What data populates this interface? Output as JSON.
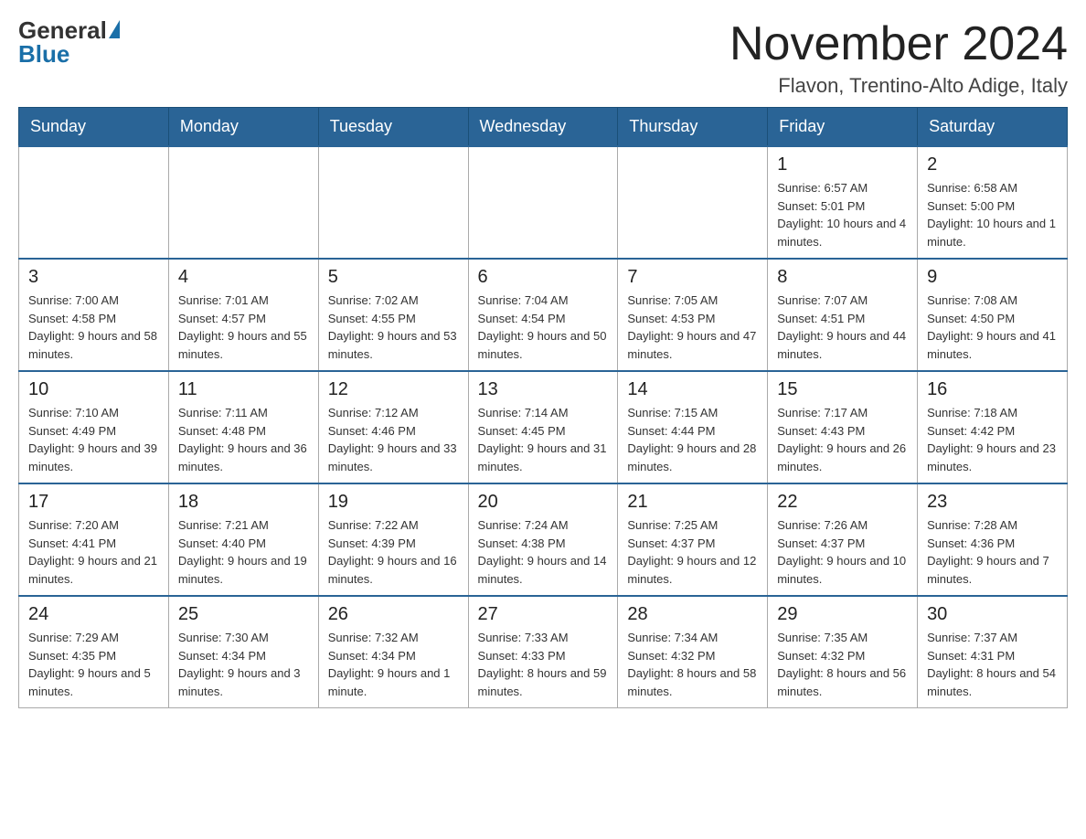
{
  "logo": {
    "general": "General",
    "blue": "Blue",
    "triangle": "▶"
  },
  "header": {
    "month_title": "November 2024",
    "location": "Flavon, Trentino-Alto Adige, Italy"
  },
  "weekdays": [
    "Sunday",
    "Monday",
    "Tuesday",
    "Wednesday",
    "Thursday",
    "Friday",
    "Saturday"
  ],
  "weeks": [
    [
      {
        "day": "",
        "info": ""
      },
      {
        "day": "",
        "info": ""
      },
      {
        "day": "",
        "info": ""
      },
      {
        "day": "",
        "info": ""
      },
      {
        "day": "",
        "info": ""
      },
      {
        "day": "1",
        "info": "Sunrise: 6:57 AM\nSunset: 5:01 PM\nDaylight: 10 hours and 4 minutes."
      },
      {
        "day": "2",
        "info": "Sunrise: 6:58 AM\nSunset: 5:00 PM\nDaylight: 10 hours and 1 minute."
      }
    ],
    [
      {
        "day": "3",
        "info": "Sunrise: 7:00 AM\nSunset: 4:58 PM\nDaylight: 9 hours and 58 minutes."
      },
      {
        "day": "4",
        "info": "Sunrise: 7:01 AM\nSunset: 4:57 PM\nDaylight: 9 hours and 55 minutes."
      },
      {
        "day": "5",
        "info": "Sunrise: 7:02 AM\nSunset: 4:55 PM\nDaylight: 9 hours and 53 minutes."
      },
      {
        "day": "6",
        "info": "Sunrise: 7:04 AM\nSunset: 4:54 PM\nDaylight: 9 hours and 50 minutes."
      },
      {
        "day": "7",
        "info": "Sunrise: 7:05 AM\nSunset: 4:53 PM\nDaylight: 9 hours and 47 minutes."
      },
      {
        "day": "8",
        "info": "Sunrise: 7:07 AM\nSunset: 4:51 PM\nDaylight: 9 hours and 44 minutes."
      },
      {
        "day": "9",
        "info": "Sunrise: 7:08 AM\nSunset: 4:50 PM\nDaylight: 9 hours and 41 minutes."
      }
    ],
    [
      {
        "day": "10",
        "info": "Sunrise: 7:10 AM\nSunset: 4:49 PM\nDaylight: 9 hours and 39 minutes."
      },
      {
        "day": "11",
        "info": "Sunrise: 7:11 AM\nSunset: 4:48 PM\nDaylight: 9 hours and 36 minutes."
      },
      {
        "day": "12",
        "info": "Sunrise: 7:12 AM\nSunset: 4:46 PM\nDaylight: 9 hours and 33 minutes."
      },
      {
        "day": "13",
        "info": "Sunrise: 7:14 AM\nSunset: 4:45 PM\nDaylight: 9 hours and 31 minutes."
      },
      {
        "day": "14",
        "info": "Sunrise: 7:15 AM\nSunset: 4:44 PM\nDaylight: 9 hours and 28 minutes."
      },
      {
        "day": "15",
        "info": "Sunrise: 7:17 AM\nSunset: 4:43 PM\nDaylight: 9 hours and 26 minutes."
      },
      {
        "day": "16",
        "info": "Sunrise: 7:18 AM\nSunset: 4:42 PM\nDaylight: 9 hours and 23 minutes."
      }
    ],
    [
      {
        "day": "17",
        "info": "Sunrise: 7:20 AM\nSunset: 4:41 PM\nDaylight: 9 hours and 21 minutes."
      },
      {
        "day": "18",
        "info": "Sunrise: 7:21 AM\nSunset: 4:40 PM\nDaylight: 9 hours and 19 minutes."
      },
      {
        "day": "19",
        "info": "Sunrise: 7:22 AM\nSunset: 4:39 PM\nDaylight: 9 hours and 16 minutes."
      },
      {
        "day": "20",
        "info": "Sunrise: 7:24 AM\nSunset: 4:38 PM\nDaylight: 9 hours and 14 minutes."
      },
      {
        "day": "21",
        "info": "Sunrise: 7:25 AM\nSunset: 4:37 PM\nDaylight: 9 hours and 12 minutes."
      },
      {
        "day": "22",
        "info": "Sunrise: 7:26 AM\nSunset: 4:37 PM\nDaylight: 9 hours and 10 minutes."
      },
      {
        "day": "23",
        "info": "Sunrise: 7:28 AM\nSunset: 4:36 PM\nDaylight: 9 hours and 7 minutes."
      }
    ],
    [
      {
        "day": "24",
        "info": "Sunrise: 7:29 AM\nSunset: 4:35 PM\nDaylight: 9 hours and 5 minutes."
      },
      {
        "day": "25",
        "info": "Sunrise: 7:30 AM\nSunset: 4:34 PM\nDaylight: 9 hours and 3 minutes."
      },
      {
        "day": "26",
        "info": "Sunrise: 7:32 AM\nSunset: 4:34 PM\nDaylight: 9 hours and 1 minute."
      },
      {
        "day": "27",
        "info": "Sunrise: 7:33 AM\nSunset: 4:33 PM\nDaylight: 8 hours and 59 minutes."
      },
      {
        "day": "28",
        "info": "Sunrise: 7:34 AM\nSunset: 4:32 PM\nDaylight: 8 hours and 58 minutes."
      },
      {
        "day": "29",
        "info": "Sunrise: 7:35 AM\nSunset: 4:32 PM\nDaylight: 8 hours and 56 minutes."
      },
      {
        "day": "30",
        "info": "Sunrise: 7:37 AM\nSunset: 4:31 PM\nDaylight: 8 hours and 54 minutes."
      }
    ]
  ]
}
